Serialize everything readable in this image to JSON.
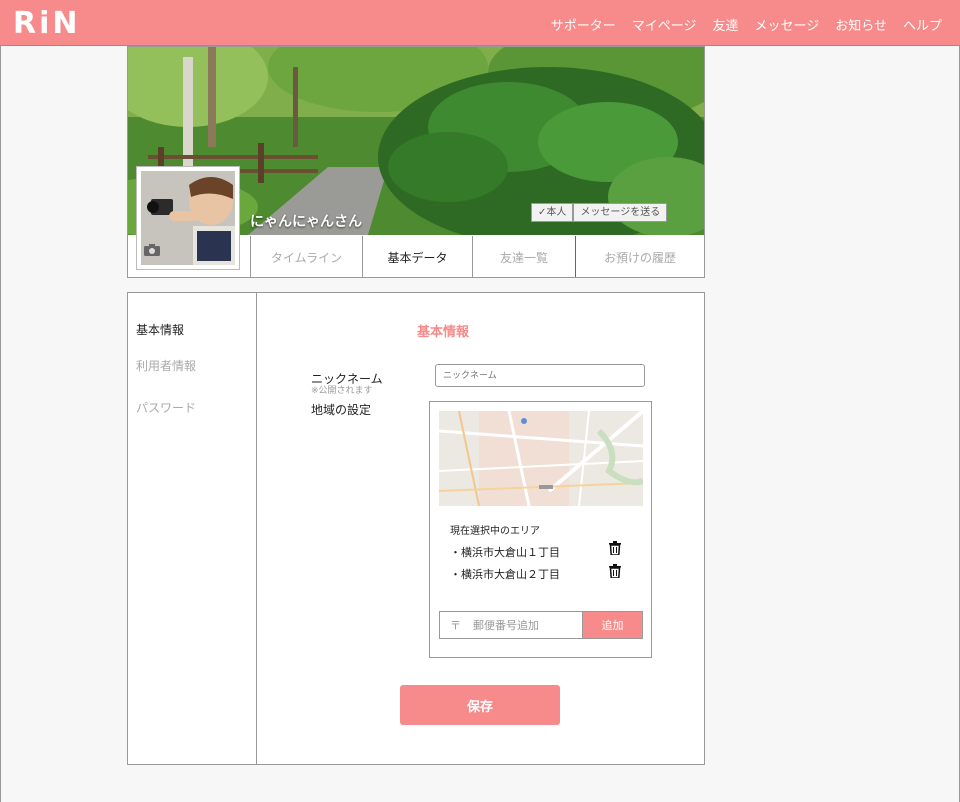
{
  "header": {
    "logo": "RiN",
    "nav": [
      "サポーター",
      "マイページ",
      "友達",
      "メッセージ",
      "お知らせ",
      "ヘルプ"
    ]
  },
  "profile": {
    "name": "にゃんにゃんさん",
    "self_badge": "✓本人",
    "send_message": "メッセージを送る",
    "tabs": [
      "タイムライン",
      "基本データ",
      "友達一覧",
      "お預けの履歴"
    ]
  },
  "sidebar": {
    "items": [
      "基本情報",
      "利用者情報",
      "パスワード"
    ]
  },
  "form": {
    "title": "基本情報",
    "nickname_label": "ニックネーム",
    "nickname_note": "※公開されます",
    "nickname_placeholder": "ニックネーム",
    "region_label": "地域の設定",
    "current_area_heading": "現在選択中のエリア",
    "areas": [
      "・横浜市大倉山１丁目",
      "・横浜市大倉山２丁目"
    ],
    "zip_mark": "〒",
    "zip_placeholder": "郵便番号追加",
    "add_button": "追加",
    "save_button": "保存"
  },
  "colors": {
    "accent": "#f78a8a"
  }
}
